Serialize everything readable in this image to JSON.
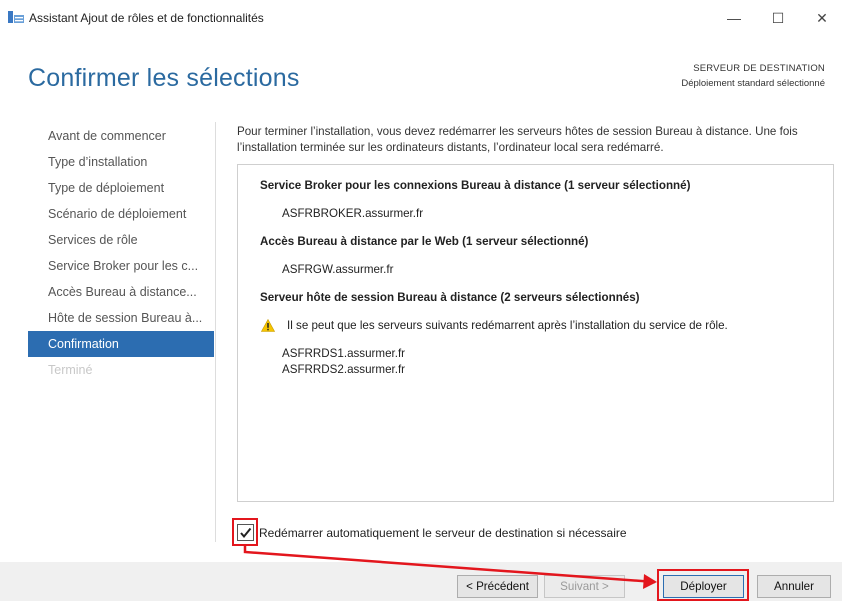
{
  "window": {
    "title": "Assistant Ajout de rôles et de fonctionnalités",
    "controls": {
      "minimize": "—",
      "maximize": "☐",
      "close": "✕"
    }
  },
  "header": {
    "page_title": "Confirmer les sélections",
    "destination_label": "SERVEUR DE DESTINATION",
    "destination_value": "Déploiement standard sélectionné"
  },
  "sidebar": {
    "items": [
      {
        "label": "Avant de commencer",
        "state": "normal"
      },
      {
        "label": "Type d’installation",
        "state": "normal"
      },
      {
        "label": "Type de déploiement",
        "state": "normal"
      },
      {
        "label": "Scénario de déploiement",
        "state": "normal"
      },
      {
        "label": "Services de rôle",
        "state": "normal"
      },
      {
        "label": "Service Broker pour les c...",
        "state": "normal"
      },
      {
        "label": "Accès Bureau à distance...",
        "state": "normal"
      },
      {
        "label": "Hôte de session Bureau à...",
        "state": "normal"
      },
      {
        "label": "Confirmation",
        "state": "active"
      },
      {
        "label": "Terminé",
        "state": "disabled"
      }
    ]
  },
  "main": {
    "intro_text": "Pour terminer l’installation, vous devez redémarrer les serveurs hôtes de session Bureau à distance. Une fois l’installation terminée sur les ordinateurs distants, l’ordinateur local sera redémarré.",
    "sections": [
      {
        "title": "Service Broker pour les connexions Bureau à distance  (1 serveur sélectionné)",
        "servers": [
          "ASFRBROKER.assurmer.fr"
        ]
      },
      {
        "title": "Accès Bureau à distance par le Web  (1 serveur sélectionné)",
        "servers": [
          "ASFRGW.assurmer.fr"
        ]
      },
      {
        "title": "Serveur hôte de session Bureau à distance  (2 serveurs sélectionnés)",
        "warning": "Il se peut que les serveurs suivants redémarrent après l’installation du service de rôle.",
        "servers": [
          "ASFRRDS1.assurmer.fr",
          "ASFRRDS2.assurmer.fr"
        ]
      }
    ],
    "restart_checkbox": {
      "label": "Redémarrer automatiquement le serveur de destination si nécessaire",
      "checked": true
    }
  },
  "footer": {
    "previous": "< Précédent",
    "next": "Suivant >",
    "deploy": "Déployer",
    "cancel": "Annuler"
  },
  "annotations": {
    "highlight_color": "#e3161d"
  },
  "colors": {
    "accent": "#2c6db1",
    "title": "#2b6aa0",
    "warning": "#f5c400"
  }
}
